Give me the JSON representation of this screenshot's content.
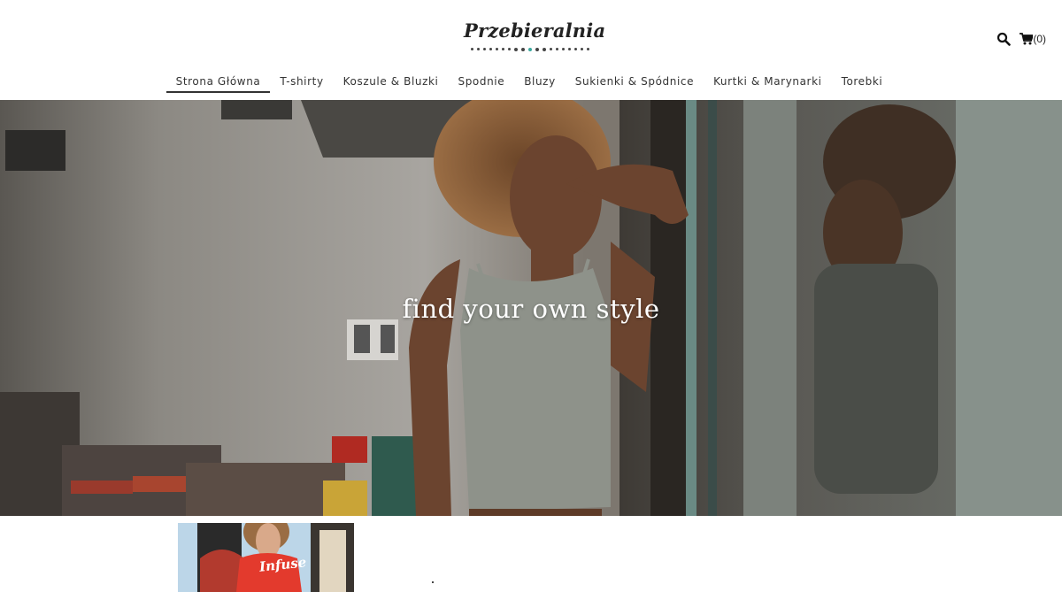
{
  "brand": {
    "name": "Przebieralnia"
  },
  "header": {
    "cart_count": "(0)"
  },
  "nav": {
    "items": [
      {
        "label": "Strona Główna",
        "active": true
      },
      {
        "label": "T-shirty"
      },
      {
        "label": "Koszule & Bluzki"
      },
      {
        "label": "Spodnie"
      },
      {
        "label": "Bluzy"
      },
      {
        "label": "Sukienki & Spódnice"
      },
      {
        "label": "Kurtki & Marynarki"
      },
      {
        "label": "Torebki"
      }
    ]
  },
  "hero": {
    "title": "find your own style"
  },
  "product": {
    "shirt_text": "Infuse"
  },
  "icons": {
    "search": "search-icon",
    "cart": "cart-icon"
  },
  "colors": {
    "accent": "#3aa89d",
    "nav_underline": "#333333",
    "hero_text": "#ffffff"
  }
}
